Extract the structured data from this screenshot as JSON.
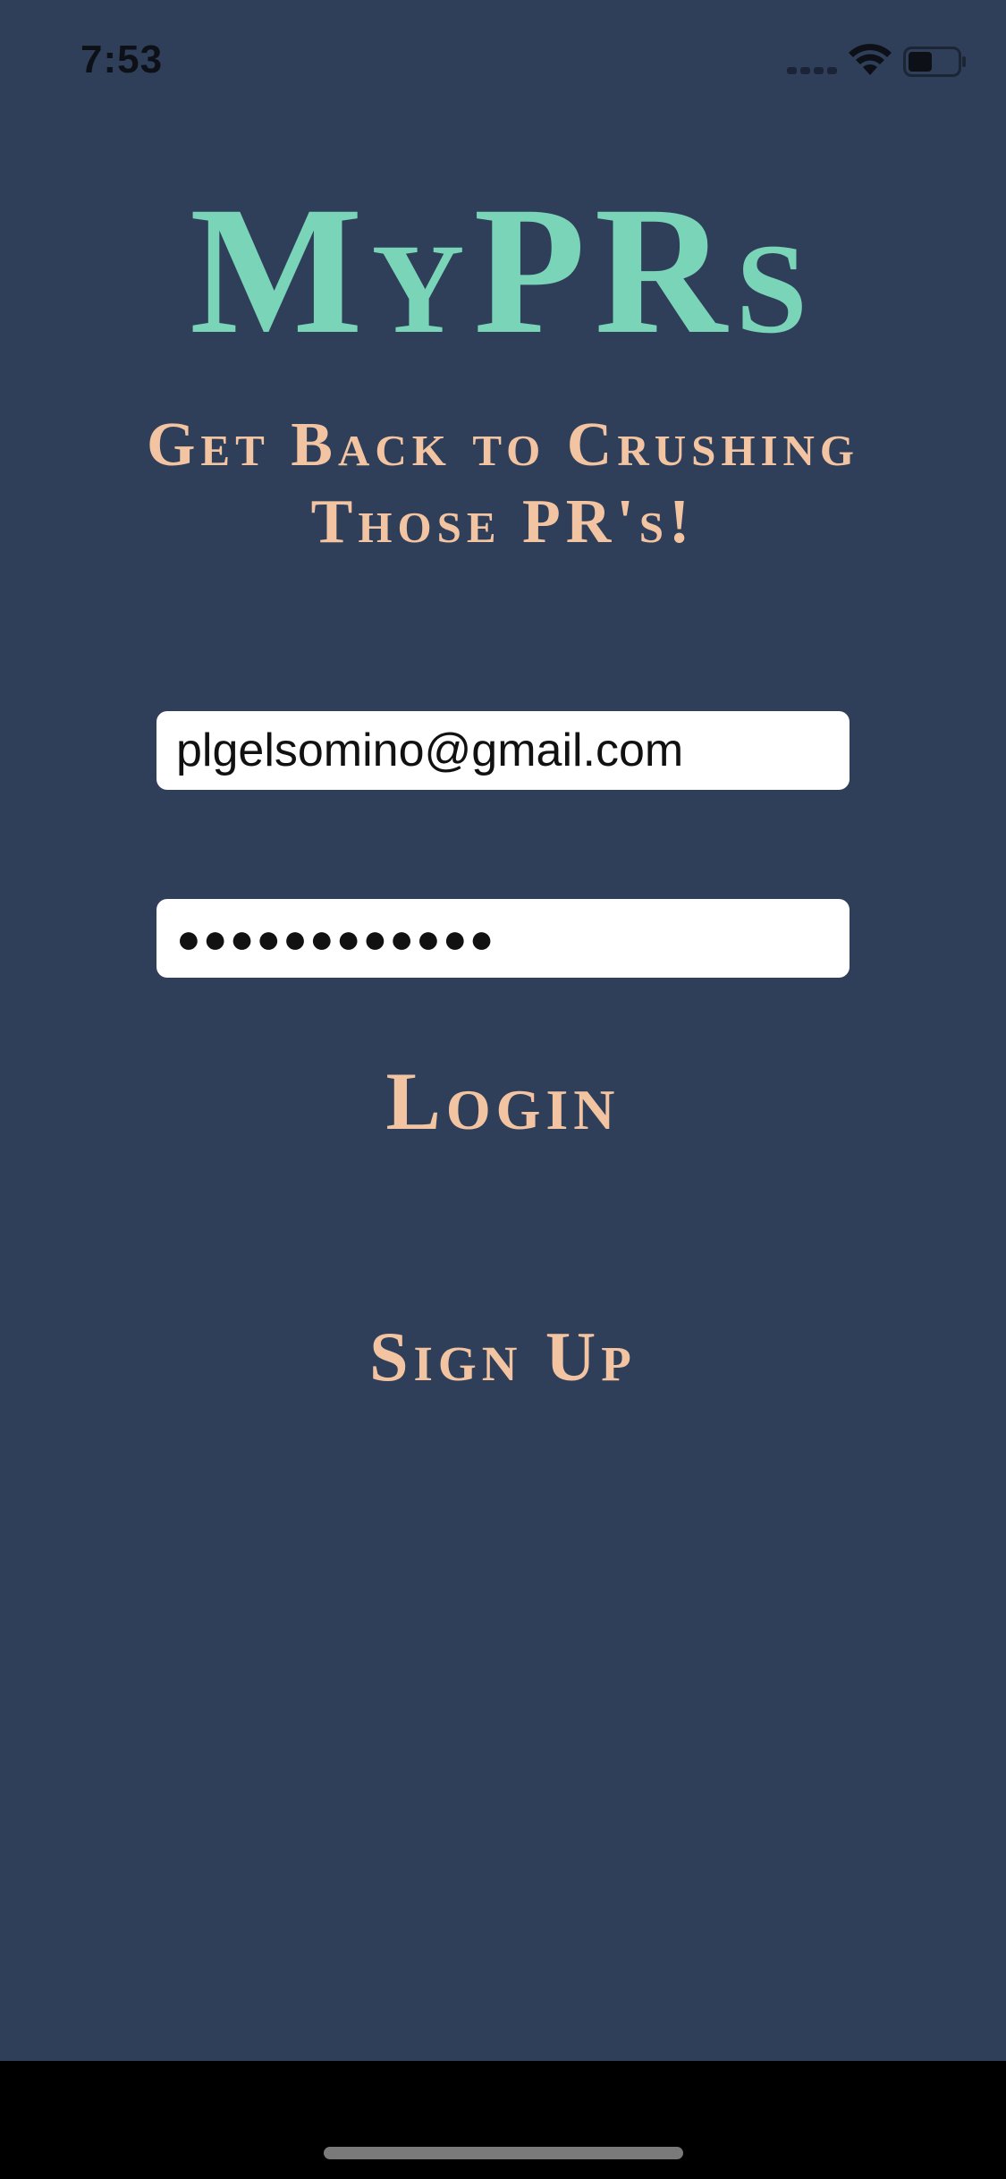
{
  "status_bar": {
    "time": "7:53"
  },
  "app": {
    "title": "MyPRs",
    "tagline": "Get Back to Crushing Those PR's!"
  },
  "form": {
    "email_value": "plgelsomino@gmail.com",
    "password_masked": "●●●●●●●●●●●●",
    "login_label": "Login",
    "signup_label": "Sign Up"
  },
  "colors": {
    "background": "#2f3f59",
    "title": "#7ad4b8",
    "accent": "#f2c4a2"
  },
  "icons": {
    "wifi": "wifi-icon",
    "battery": "battery-icon",
    "signal": "cellular-signal-icon"
  }
}
